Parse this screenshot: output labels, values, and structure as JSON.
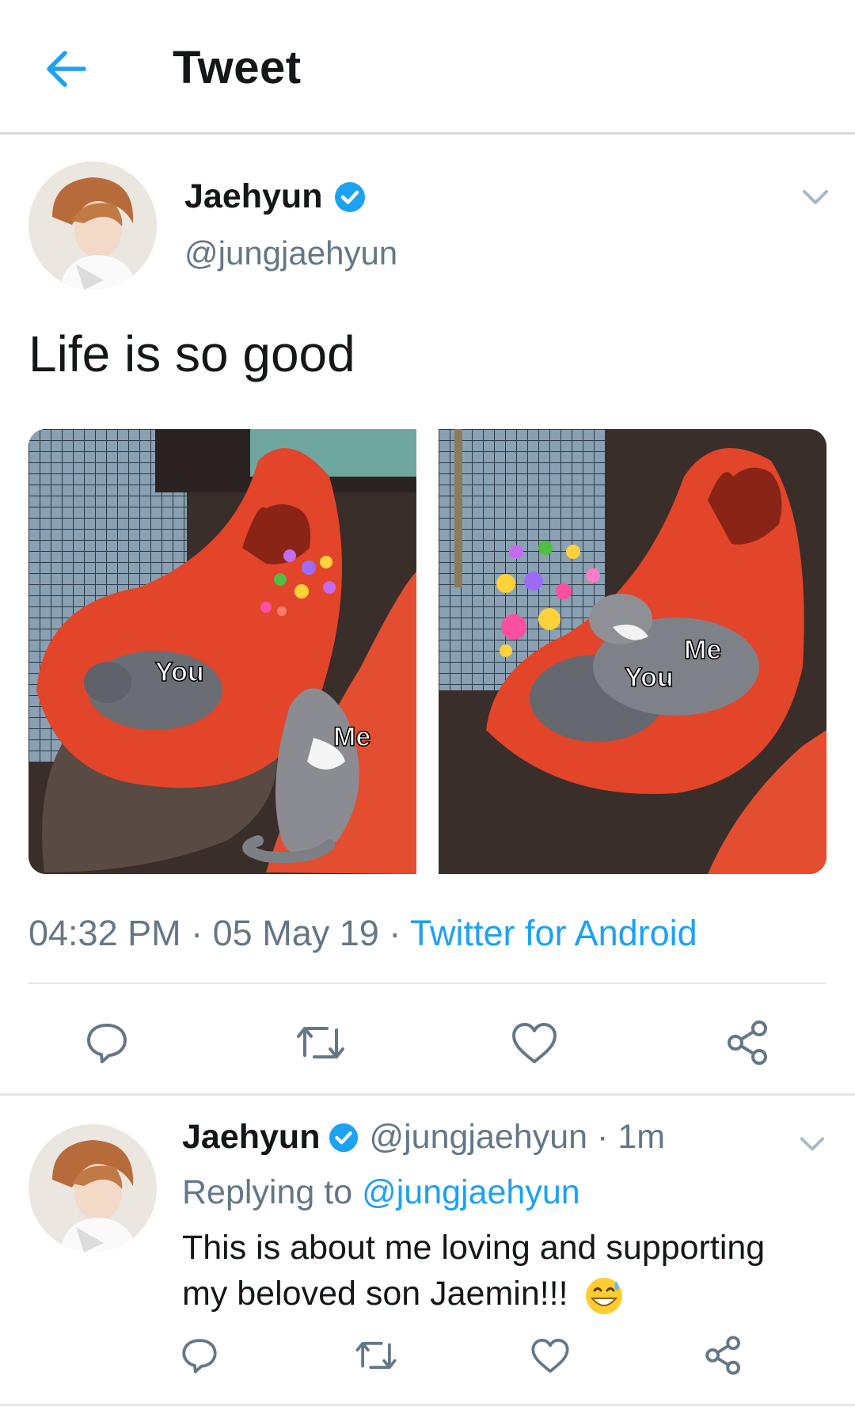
{
  "header": {
    "title": "Tweet",
    "back_icon": "arrow-left-icon"
  },
  "colors": {
    "accent": "#1da1f2",
    "secondary_text": "#657786",
    "primary_text": "#14171a",
    "divider": "#e1e8ed"
  },
  "tweet": {
    "author_name": "Jaehyun",
    "author_handle": "@jungjaehyun",
    "text": "Life is so good",
    "media": [
      {
        "labels": [
          "You",
          "Me"
        ]
      },
      {
        "labels": [
          "You",
          "Me"
        ]
      }
    ],
    "time": "04:32 PM",
    "date": "05 May 19",
    "separator": "·",
    "source": "Twitter for Android",
    "actions": [
      "reply-icon",
      "retweet-icon",
      "like-icon",
      "share-icon"
    ]
  },
  "reply": {
    "author_name": "Jaehyun",
    "author_handle": "@jungjaehyun",
    "age": "1m",
    "replying_prefix": "Replying to",
    "replying_to": "@jungjaehyun",
    "text": "This is about me loving and supporting my beloved son Jaemin!!!",
    "emoji": "grinning-sweat-emoji",
    "actions": [
      "reply-icon",
      "retweet-icon",
      "like-icon",
      "share-icon"
    ]
  }
}
